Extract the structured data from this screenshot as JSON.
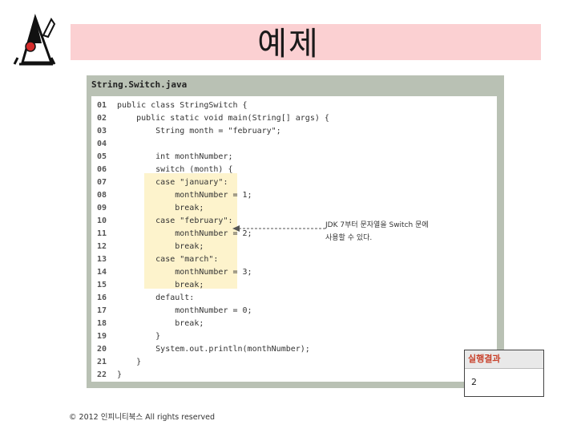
{
  "slide": {
    "title": "예제",
    "footer": "© 2012 인피니티북스 All rights reserved"
  },
  "code_panel": {
    "file_name": "String.Switch.java",
    "lines": [
      {
        "num": "01",
        "code": "public class StringSwitch {"
      },
      {
        "num": "02",
        "code": "    public static void main(String[] args) {"
      },
      {
        "num": "03",
        "code": "        String month = \"february\";"
      },
      {
        "num": "04",
        "code": ""
      },
      {
        "num": "05",
        "code": "        int monthNumber;"
      },
      {
        "num": "06",
        "code": "        switch (month) {"
      },
      {
        "num": "07",
        "code": "        case \"january\":"
      },
      {
        "num": "08",
        "code": "            monthNumber = 1;"
      },
      {
        "num": "09",
        "code": "            break;"
      },
      {
        "num": "10",
        "code": "        case \"february\":"
      },
      {
        "num": "11",
        "code": "            monthNumber = 2;"
      },
      {
        "num": "12",
        "code": "            break;"
      },
      {
        "num": "13",
        "code": "        case \"march\":"
      },
      {
        "num": "14",
        "code": "            monthNumber = 3;"
      },
      {
        "num": "15",
        "code": "            break;"
      },
      {
        "num": "16",
        "code": "        default:"
      },
      {
        "num": "17",
        "code": "            monthNumber = 0;"
      },
      {
        "num": "18",
        "code": "            break;"
      },
      {
        "num": "19",
        "code": "        }"
      },
      {
        "num": "20",
        "code": "        System.out.println(monthNumber);"
      },
      {
        "num": "21",
        "code": "    }"
      },
      {
        "num": "22",
        "code": "}"
      }
    ]
  },
  "annotation": {
    "line1": "JDK 7부터 문자열을 Switch 문에",
    "line2": "사용할 수 있다."
  },
  "result": {
    "label": "실행결과",
    "value": "2"
  },
  "colors": {
    "title_band": "#fbd0d2",
    "panel_frame": "#b9c1b4",
    "highlight": "#fdf3cc",
    "result_label": "#c8402a"
  }
}
